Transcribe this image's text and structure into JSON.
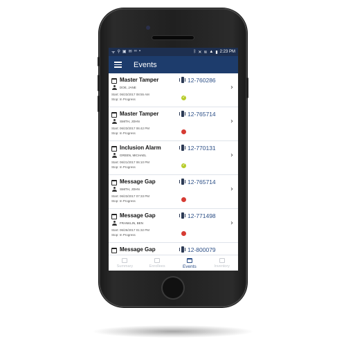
{
  "status_bar": {
    "left_icons": [
      "wifi-icon",
      "usb-icon",
      "image-icon",
      "mail-icon",
      "voicemail-icon",
      "notification-icon"
    ],
    "right_icons": [
      "bluetooth-icon",
      "mute-icon",
      "wifi-icon",
      "signal-icon",
      "battery-icon"
    ],
    "time": "2:23 PM"
  },
  "app_bar": {
    "title": "Events"
  },
  "events": [
    {
      "title": "Master Tamper",
      "number": "12-760286",
      "name": "DOE, JANE",
      "start": "Start: 06/23/2017 08:55 AM",
      "stop": "Stop: In Progress",
      "status": "green"
    },
    {
      "title": "Master Tamper",
      "number": "12-765714",
      "name": "SMITH, JOHN",
      "start": "Start: 06/23/2017 06:42 PM",
      "stop": "Stop: In Progress",
      "status": "red"
    },
    {
      "title": "Inclusion Alarm",
      "number": "12-770131",
      "name": "GREEN, MICHAEL",
      "start": "Start: 06/21/2017 06:10 PM",
      "stop": "Stop: In Progress",
      "status": "green"
    },
    {
      "title": "Message Gap",
      "number": "12-765714",
      "name": "SMITH, JOHN",
      "start": "Start: 06/23/2017 07:33 PM",
      "stop": "Stop: In Progress",
      "status": "red"
    },
    {
      "title": "Message Gap",
      "number": "12-771498",
      "name": "FRANKLIN, BEN",
      "start": "Start: 06/26/2017 01:32 PM",
      "stop": "Stop: In Progress",
      "status": "red"
    },
    {
      "title": "Message Gap",
      "number": "12-800079",
      "name": "",
      "start": "",
      "stop": "",
      "status": ""
    }
  ],
  "tabs": [
    {
      "label": "Summary",
      "icon": "summary-icon",
      "active": false
    },
    {
      "label": "Enrollees",
      "icon": "enrollees-icon",
      "active": false
    },
    {
      "label": "Events",
      "icon": "calendar-icon",
      "active": true
    },
    {
      "label": "Inventory",
      "icon": "inventory-icon",
      "active": false
    }
  ],
  "colors": {
    "status_bar": "#1d2f50",
    "app_bar": "#1d3c6c",
    "accent": "#2b4e86",
    "status_green": "#b7cc2a",
    "status_red": "#d63b33"
  }
}
